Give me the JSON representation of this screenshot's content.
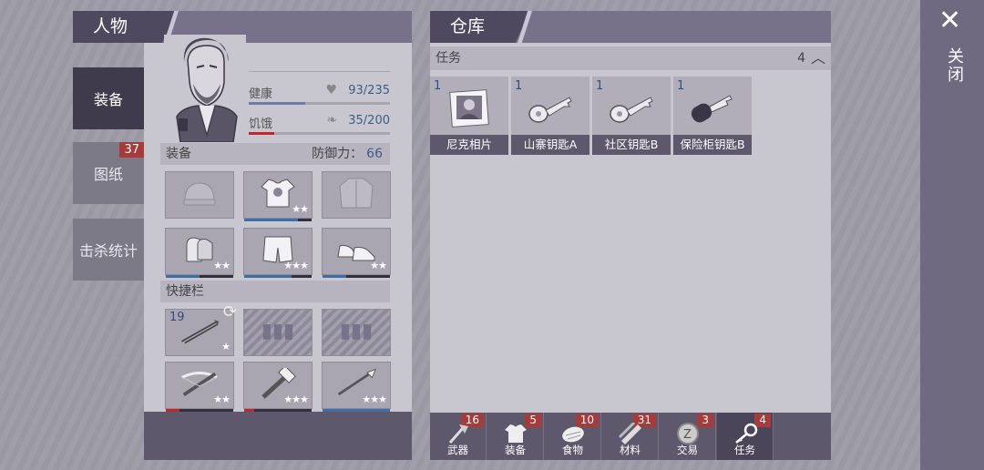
{
  "character": {
    "title": "人物",
    "tabs": [
      {
        "label": "装备",
        "badge": ""
      },
      {
        "label": "图纸",
        "badge": "37"
      },
      {
        "label": "击杀统计",
        "badge": ""
      }
    ],
    "stats": {
      "health_label": "健康",
      "health_value": "93/235",
      "health_fraction": 0.4,
      "hunger_label": "饥饿",
      "hunger_value": "35/200",
      "hunger_fraction": 0.18
    },
    "equipment_label": "装备",
    "defense_label": "防御力：",
    "defense_value": "66",
    "quickbar_label": "快捷栏",
    "quickbar_first_count": "19"
  },
  "warehouse": {
    "title": "仓库",
    "category_label": "任务",
    "category_count": "4",
    "items": [
      {
        "qty": "1",
        "name": "尼克相片",
        "icon": "photo-icon"
      },
      {
        "qty": "1",
        "name": "山寨钥匙A",
        "icon": "key-icon"
      },
      {
        "qty": "1",
        "name": "社区钥匙B",
        "icon": "key-icon"
      },
      {
        "qty": "1",
        "name": "保险柜钥匙B",
        "icon": "car-key-icon"
      }
    ],
    "footer_tabs": [
      {
        "label": "武器",
        "badge": "16",
        "icon": "axe-icon"
      },
      {
        "label": "装备",
        "badge": "5",
        "icon": "shirt-icon"
      },
      {
        "label": "食物",
        "badge": "10",
        "icon": "meat-icon"
      },
      {
        "label": "材料",
        "badge": "31",
        "icon": "planks-icon"
      },
      {
        "label": "交易",
        "badge": "3",
        "icon": "coin-icon"
      },
      {
        "label": "任务",
        "badge": "4",
        "icon": "key-icon"
      }
    ]
  },
  "close": {
    "label": "关闭"
  },
  "colors": {
    "accent": "#4f4960",
    "badge": "#a83a3a",
    "value": "#3c5e8a"
  }
}
